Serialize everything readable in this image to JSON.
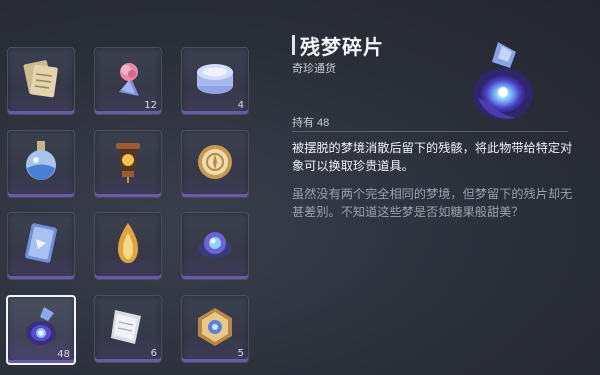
{
  "inventory": {
    "slots": [
      {
        "name": "paper-scroll-item",
        "icon": "paper-bundle-icon",
        "count": ""
      },
      {
        "name": "rose-bouquet-item",
        "icon": "rose-icon",
        "count": "12"
      },
      {
        "name": "jar-item",
        "icon": "jar-icon",
        "count": "4"
      },
      {
        "name": "potion-item",
        "icon": "potion-flask-icon",
        "count": ""
      },
      {
        "name": "lantern-item",
        "icon": "lantern-icon",
        "count": ""
      },
      {
        "name": "coin-item",
        "icon": "gold-coin-icon",
        "count": ""
      },
      {
        "name": "card-item",
        "icon": "blue-card-icon",
        "count": ""
      },
      {
        "name": "flame-drop-item",
        "icon": "golden-flame-icon",
        "count": ""
      },
      {
        "name": "blue-orb-item",
        "icon": "blue-orb-icon",
        "count": ""
      },
      {
        "name": "dream-shard-item",
        "icon": "dream-shard-icon",
        "count": "48"
      },
      {
        "name": "paper-strip-item",
        "icon": "paper-strip-icon",
        "count": "6"
      },
      {
        "name": "ornate-box-item",
        "icon": "ornate-box-icon",
        "count": "5"
      }
    ]
  },
  "detail": {
    "title": "残梦碎片",
    "subtitle": "奇珍通货",
    "hold_text": "持有 48",
    "description": "被摆脱的梦境消散后留下的残骸，将此物带给特定对象可以换取珍贵道具。",
    "flavor": "虽然没有两个完全相同的梦境，但梦留下的残片却无甚差别。不知道这些梦是否如糖果般甜美？"
  },
  "colors": {
    "background": "#2b2f3a",
    "slot_accent": "#6b5aa8",
    "selected_border": "#f2f3f6"
  }
}
